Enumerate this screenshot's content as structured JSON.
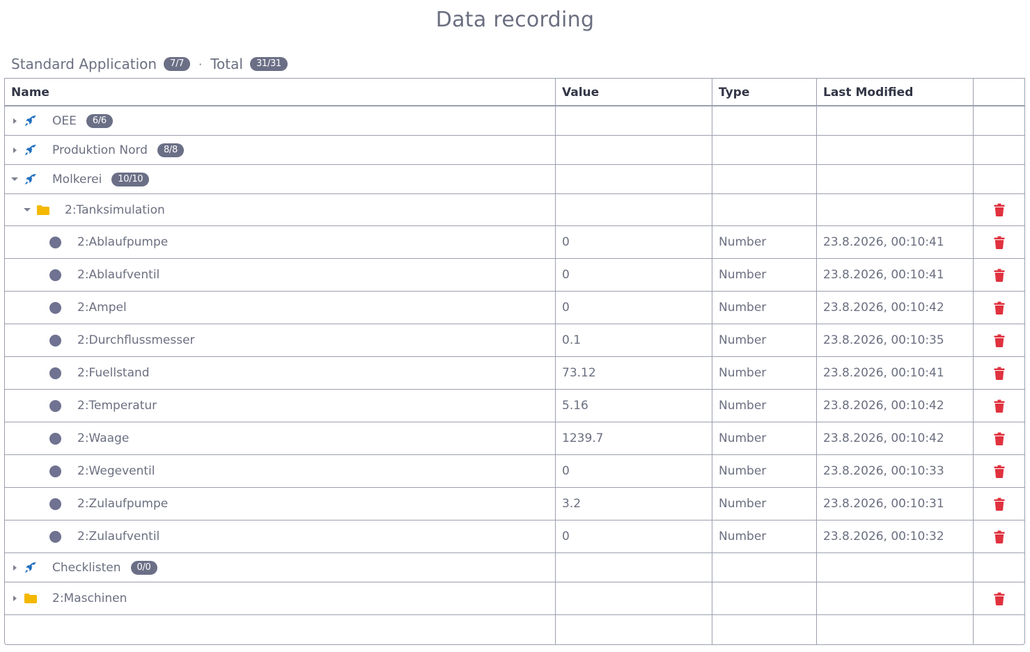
{
  "title": "Data recording",
  "summary": {
    "app_label": "Standard Application",
    "app_count": "7/7",
    "separator": "·",
    "total_label": "Total",
    "total_count": "31/31"
  },
  "columns": {
    "name": "Name",
    "value": "Value",
    "type": "Type",
    "last_modified": "Last Modified"
  },
  "rows": [
    {
      "kind": "app",
      "label": "OEE",
      "count": "6/6",
      "expanded": false
    },
    {
      "kind": "app",
      "label": "Produktion Nord",
      "count": "8/8",
      "expanded": false
    },
    {
      "kind": "app",
      "label": "Molkerei",
      "count": "10/10",
      "expanded": true
    },
    {
      "kind": "folder",
      "label": "2:Tanksimulation",
      "expanded": true,
      "deletable": true
    },
    {
      "kind": "var",
      "label": "2:Ablaufpumpe",
      "value": "0",
      "type": "Number",
      "modified": "23.8.2026, 00:10:41"
    },
    {
      "kind": "var",
      "label": "2:Ablaufventil",
      "value": "0",
      "type": "Number",
      "modified": "23.8.2026, 00:10:41"
    },
    {
      "kind": "var",
      "label": "2:Ampel",
      "value": "0",
      "type": "Number",
      "modified": "23.8.2026, 00:10:42"
    },
    {
      "kind": "var",
      "label": "2:Durchflussmesser",
      "value": "0.1",
      "type": "Number",
      "modified": "23.8.2026, 00:10:35"
    },
    {
      "kind": "var",
      "label": "2:Fuellstand",
      "value": "73.12",
      "type": "Number",
      "modified": "23.8.2026, 00:10:41"
    },
    {
      "kind": "var",
      "label": "2:Temperatur",
      "value": "5.16",
      "type": "Number",
      "modified": "23.8.2026, 00:10:42"
    },
    {
      "kind": "var",
      "label": "2:Waage",
      "value": "1239.7",
      "type": "Number",
      "modified": "23.8.2026, 00:10:42"
    },
    {
      "kind": "var",
      "label": "2:Wegeventil",
      "value": "0",
      "type": "Number",
      "modified": "23.8.2026, 00:10:33"
    },
    {
      "kind": "var",
      "label": "2:Zulaufpumpe",
      "value": "3.2",
      "type": "Number",
      "modified": "23.8.2026, 00:10:31"
    },
    {
      "kind": "var",
      "label": "2:Zulaufventil",
      "value": "0",
      "type": "Number",
      "modified": "23.8.2026, 00:10:32"
    },
    {
      "kind": "app",
      "label": "Checklisten",
      "count": "0/0",
      "expanded": false
    },
    {
      "kind": "folder",
      "label": "2:Maschinen",
      "expanded": false,
      "deletable": true
    }
  ],
  "icons": {
    "app": "rocket-icon",
    "folder": "folder-icon",
    "variable": "circle-icon",
    "delete": "trash-icon",
    "expand": "caret-right-icon",
    "collapse": "caret-down-icon"
  },
  "colors": {
    "rocket": "#1f6fbf",
    "folder": "#f5b800",
    "trash": "#e0313e",
    "badge": "#6b6f86",
    "dot": "#6f7290"
  }
}
